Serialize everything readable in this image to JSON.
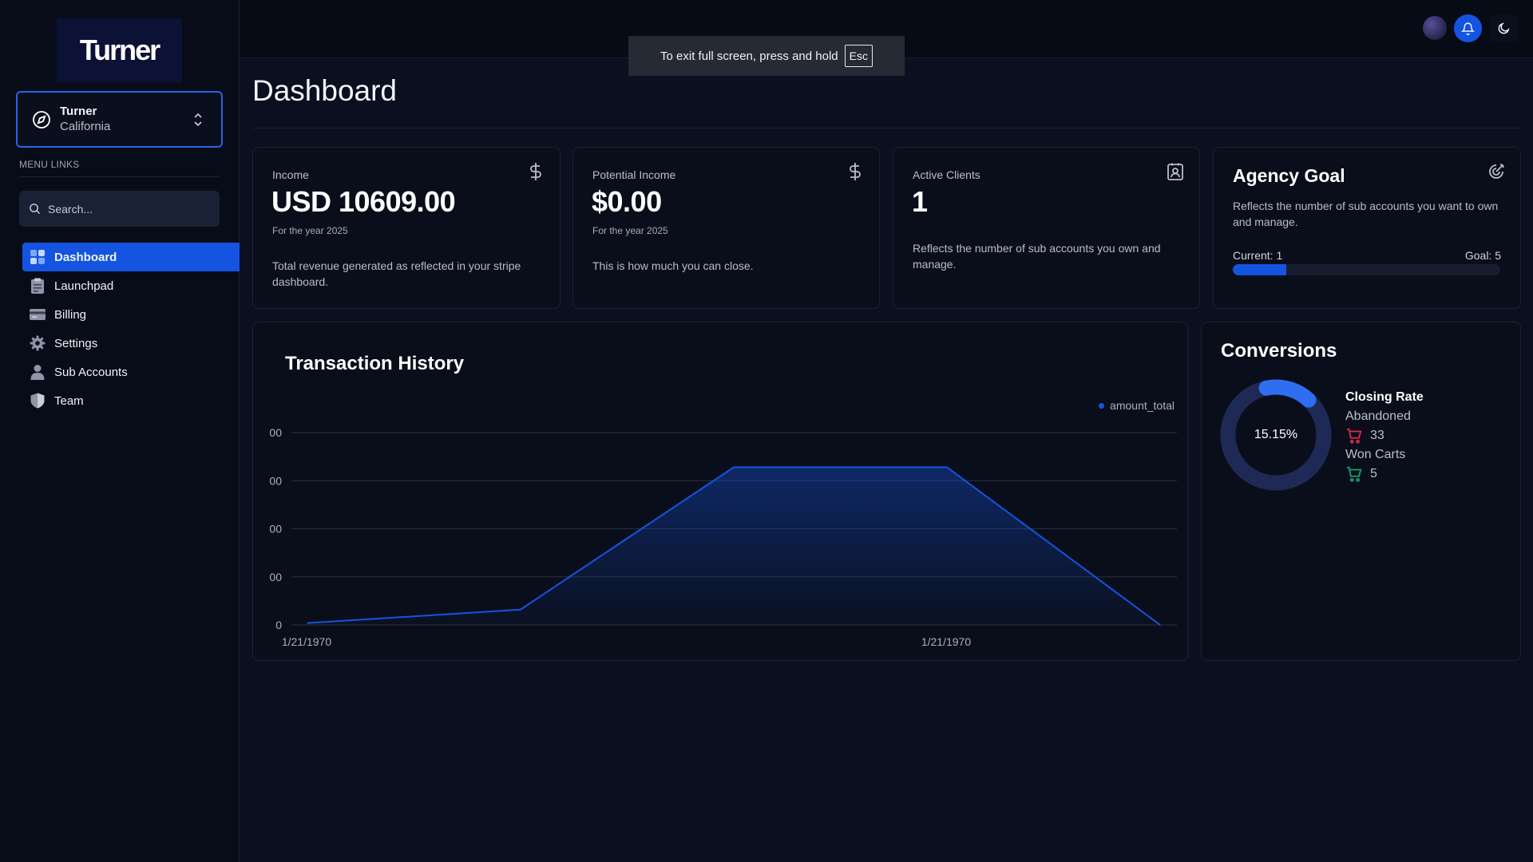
{
  "sidebar": {
    "logo_text": "Turner",
    "account": {
      "name": "Turner",
      "location": "California"
    },
    "menu_heading": "MENU LINKS",
    "search_placeholder": "Search...",
    "items": [
      {
        "label": "Dashboard",
        "icon": "dashboard-icon",
        "active": true
      },
      {
        "label": "Launchpad",
        "icon": "clipboard-icon",
        "active": false
      },
      {
        "label": "Billing",
        "icon": "credit-card-icon",
        "active": false
      },
      {
        "label": "Settings",
        "icon": "gear-icon",
        "active": false
      },
      {
        "label": "Sub Accounts",
        "icon": "person-icon",
        "active": false
      },
      {
        "label": "Team",
        "icon": "shield-icon",
        "active": false
      }
    ]
  },
  "topbar": {
    "fullscreen_notice": "To exit full screen, press and hold",
    "esc_key": "Esc",
    "icons": [
      "avatar",
      "bell-icon",
      "moon-icon"
    ]
  },
  "page": {
    "title": "Dashboard"
  },
  "cards": {
    "income": {
      "label": "Income",
      "value": "USD 10609.00",
      "period": "For the year 2025",
      "description": "Total revenue generated as reflected in your stripe dashboard.",
      "icon": "dollar-icon"
    },
    "potential": {
      "label": "Potential Income",
      "value": "$0.00",
      "period": "For the year 2025",
      "description": "This is how much you can close.",
      "icon": "dollar-icon"
    },
    "clients": {
      "label": "Active Clients",
      "value": "1",
      "description": "Reflects the number of sub accounts you own and manage.",
      "icon": "contact-icon"
    },
    "goal": {
      "title": "Agency Goal",
      "description": "Reflects the number of sub accounts you want to own and manage.",
      "current_label": "Current: 1",
      "goal_label": "Goal: 5",
      "progress_fraction": 0.2,
      "icon": "target-icon"
    }
  },
  "transactions": {
    "title": "Transaction History",
    "legend": "amount_total",
    "y_tick_labels": [
      "00",
      "00",
      "00",
      "00",
      "0"
    ],
    "x_tick_labels": [
      "1/21/1970",
      "1/21/1970"
    ]
  },
  "chart_data": {
    "type": "area",
    "title": "Transaction History",
    "series": [
      {
        "name": "amount_total",
        "values": [
          0.05,
          0.4,
          4.1,
          4.1,
          0
        ]
      }
    ],
    "x": [
      0,
      1,
      2,
      3,
      4
    ],
    "x_tick_labels": [
      "1/21/1970",
      "1/21/1970"
    ],
    "y_tick_labels": [
      "0",
      "00",
      "00",
      "00",
      "00"
    ],
    "ylim": [
      0,
      5
    ],
    "grid": true,
    "legend_position": "top-right",
    "color": "#1554e0"
  },
  "conversions": {
    "title": "Conversions",
    "rate_label": "15.15%",
    "rate_fraction": 0.1515,
    "closing_rate": "Closing Rate",
    "abandoned_label": "Abandoned",
    "abandoned_count": "33",
    "won_label": "Won Carts",
    "won_count": "5",
    "colors": {
      "ring": "#1e2a55",
      "progress": "#2f6ef0",
      "abandoned": "#e0284a",
      "won": "#18a36b"
    }
  }
}
